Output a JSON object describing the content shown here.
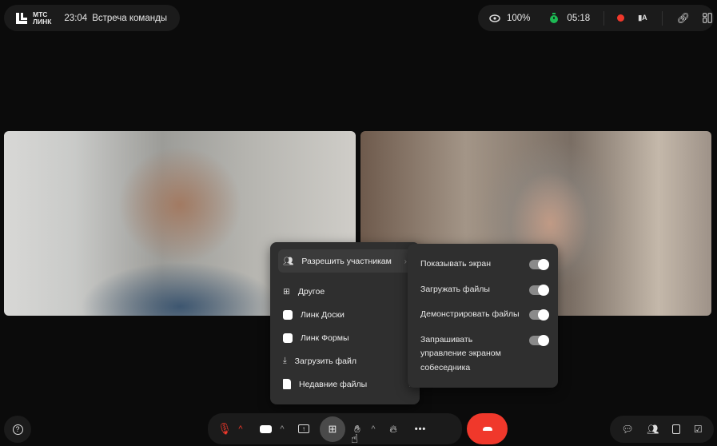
{
  "header": {
    "logo_line1": "МТС",
    "logo_line2": "ЛИНК",
    "time": "23:04",
    "title": "Встреча команды",
    "view_percent": "100%",
    "timer": "05:18",
    "accent_green": "#1db954",
    "record_color": "#f0382b"
  },
  "menu": {
    "items": [
      {
        "label": "Разрешить участникам",
        "icon": "people-icon",
        "submenu": true
      },
      {
        "label": "Другое",
        "icon": "apps-icon",
        "submenu": true
      },
      {
        "label": "Линк Доски",
        "icon": "link-boards-icon",
        "submenu": false
      },
      {
        "label": "Линк Формы",
        "icon": "link-forms-icon",
        "submenu": false
      },
      {
        "label": "Загрузить файл",
        "icon": "download-icon",
        "submenu": true
      },
      {
        "label": "Недавние файлы",
        "icon": "file-icon",
        "submenu": true
      }
    ]
  },
  "submenu": {
    "items": [
      {
        "label": "Показывать экран",
        "on": true
      },
      {
        "label": "Загружать файлы",
        "on": true
      },
      {
        "label": "Демонстрировать файлы",
        "on": true
      },
      {
        "label": "Запрашивать управление экраном собеседника",
        "on": true
      }
    ]
  },
  "toolbar": {
    "end_call_color": "#f0382b"
  }
}
